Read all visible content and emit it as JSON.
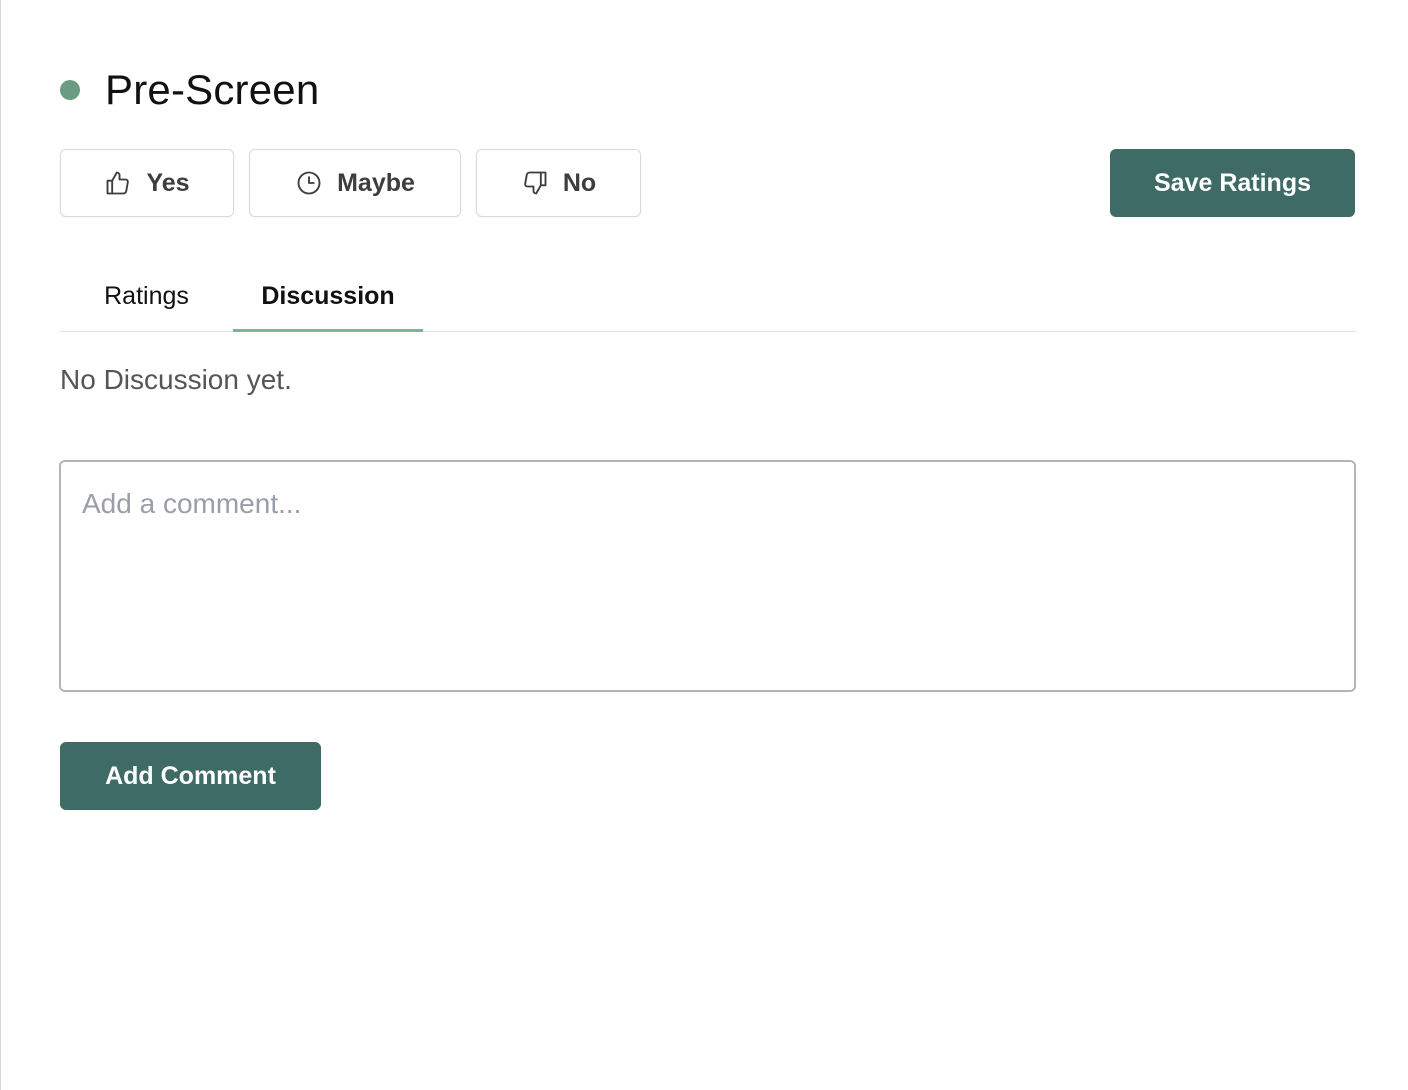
{
  "header": {
    "title": "Pre-Screen",
    "status_color": "#6b9b80"
  },
  "ratings": {
    "yes_label": "Yes",
    "yes_icon": "thumbs-up-icon",
    "maybe_label": "Maybe",
    "maybe_icon": "clock-icon",
    "no_label": "No",
    "no_icon": "thumbs-down-icon"
  },
  "actions": {
    "save_label": "Save Ratings",
    "add_comment_label": "Add Comment",
    "accent_color": "#3f6b66"
  },
  "tabs": [
    {
      "label": "Ratings",
      "active": false
    },
    {
      "label": "Discussion",
      "active": true
    }
  ],
  "discussion": {
    "empty_text": "No Discussion yet.",
    "comment_value": "",
    "comment_placeholder": "Add a comment..."
  }
}
